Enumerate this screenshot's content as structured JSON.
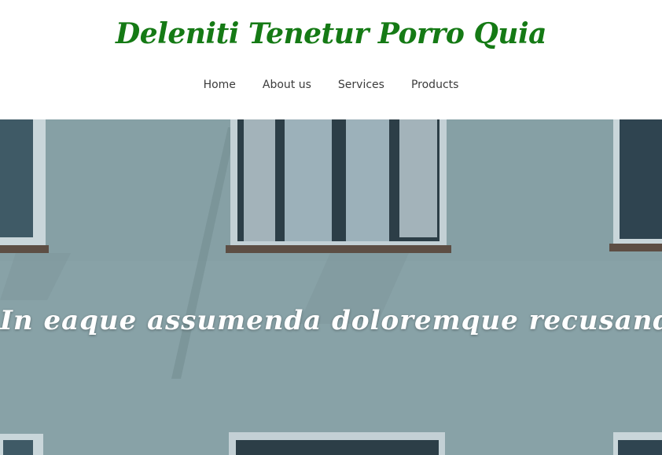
{
  "site": {
    "title": "Deleniti Tenetur Porro Quia"
  },
  "nav": {
    "items": [
      {
        "label": "Home"
      },
      {
        "label": "About us"
      },
      {
        "label": "Services"
      },
      {
        "label": "Products"
      }
    ]
  },
  "hero": {
    "heading": "In eaque assumenda doloremque recusandae"
  },
  "colors": {
    "title": "#157a15",
    "nav_text": "#3b3b3b",
    "hero_text": "#ffffff",
    "wall": "#8ba3a8"
  }
}
